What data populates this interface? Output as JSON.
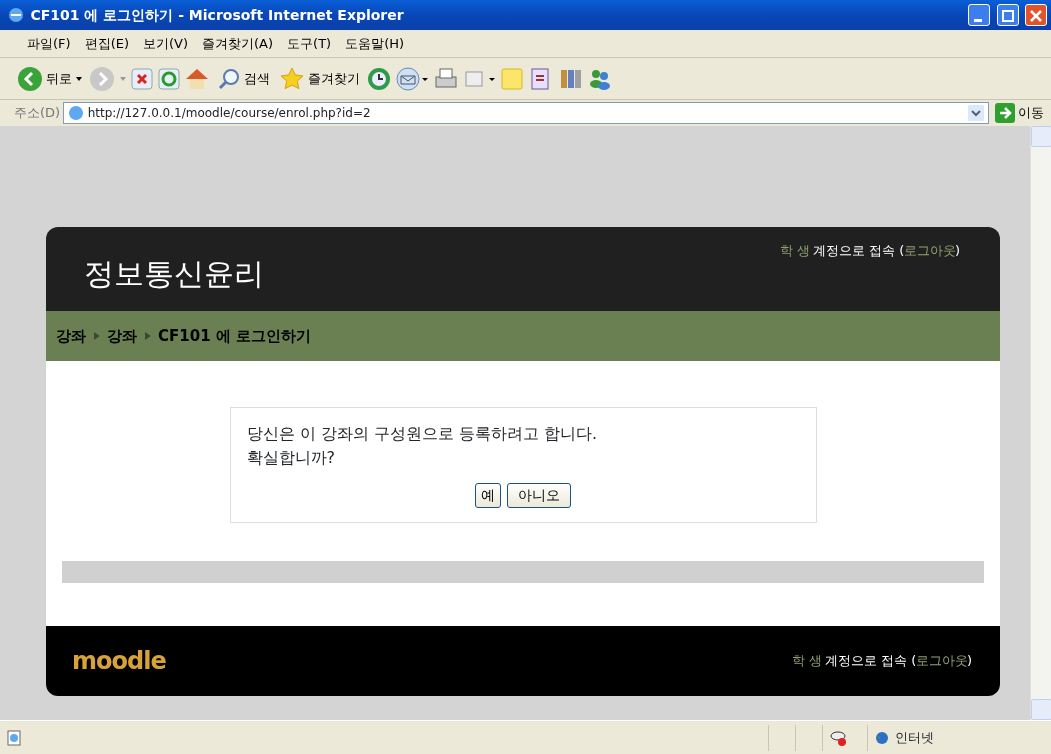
{
  "window": {
    "title": "CF101 에 로그인하기 - Microsoft Internet Explorer"
  },
  "menu": [
    "파일(F)",
    "편집(E)",
    "보기(V)",
    "즐겨찾기(A)",
    "도구(T)",
    "도움말(H)"
  ],
  "toolbar": {
    "back": "뒤로",
    "search": "검색",
    "favorites": "즐겨찾기"
  },
  "address": {
    "label": "주소(D)",
    "url": "http://127.0.0.1/moodle/course/enrol.php?id=2",
    "go": "이동"
  },
  "page": {
    "site_title": "정보통신윤리",
    "login_info": {
      "user": "학 생",
      "text": "계정으로 접속 (",
      "logout": "로그아웃",
      "close": ")"
    },
    "breadcrumb": [
      "강좌",
      "강좌",
      "CF101 에 로그인하기"
    ],
    "dialog": {
      "message": [
        "당신은 이 강좌의 구성원으로 등록하려고 합니다.",
        "확실합니까?"
      ],
      "buttons": [
        "예",
        "아니오"
      ]
    },
    "footer": {
      "logo": "moodle",
      "login_info": {
        "user": "학 생",
        "text": "계정으로 접속 (",
        "logout": "로그아웃",
        "close": ")"
      }
    }
  },
  "status_bar": {
    "zone": "인터넷"
  }
}
